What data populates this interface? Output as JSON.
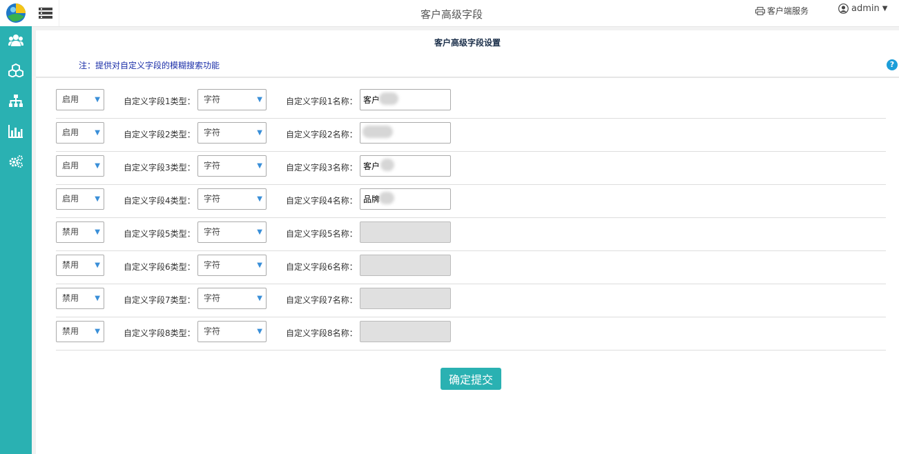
{
  "header": {
    "title": "客户高级字段",
    "client_service": "客户端服务",
    "username": "admin"
  },
  "sidebar": {
    "icons": [
      "users-icon",
      "cubes-icon",
      "sitemap-icon",
      "bar-chart-icon",
      "gears-icon"
    ]
  },
  "main": {
    "section_title": "客户高级字段设置",
    "note": "注：提供对自定义字段的模糊搜索功能",
    "help": "?",
    "rows": [
      {
        "status": "启用",
        "type_label": "自定义字段1类型：",
        "type": "字符",
        "name_label": "自定义字段1名称：",
        "name": "客户",
        "enabled": true
      },
      {
        "status": "启用",
        "type_label": "自定义字段2类型：",
        "type": "字符",
        "name_label": "自定义字段2名称：",
        "name": "",
        "enabled": true
      },
      {
        "status": "启用",
        "type_label": "自定义字段3类型：",
        "type": "字符",
        "name_label": "自定义字段3名称：",
        "name": "客户",
        "enabled": true
      },
      {
        "status": "启用",
        "type_label": "自定义字段4类型：",
        "type": "字符",
        "name_label": "自定义字段4名称：",
        "name": "品牌",
        "enabled": true
      },
      {
        "status": "禁用",
        "type_label": "自定义字段5类型：",
        "type": "字符",
        "name_label": "自定义字段5名称：",
        "name": "",
        "enabled": false
      },
      {
        "status": "禁用",
        "type_label": "自定义字段6类型：",
        "type": "字符",
        "name_label": "自定义字段6名称：",
        "name": "",
        "enabled": false
      },
      {
        "status": "禁用",
        "type_label": "自定义字段7类型：",
        "type": "字符",
        "name_label": "自定义字段7名称：",
        "name": "",
        "enabled": false
      },
      {
        "status": "禁用",
        "type_label": "自定义字段8类型：",
        "type": "字符",
        "name_label": "自定义字段8名称：",
        "name": "",
        "enabled": false
      }
    ],
    "submit_label": "确定提交"
  },
  "colors": {
    "sidebar": "#2ab1b2",
    "button": "#2ab1b2",
    "note": "#1a2ea8",
    "help": "#1c9ed9"
  }
}
